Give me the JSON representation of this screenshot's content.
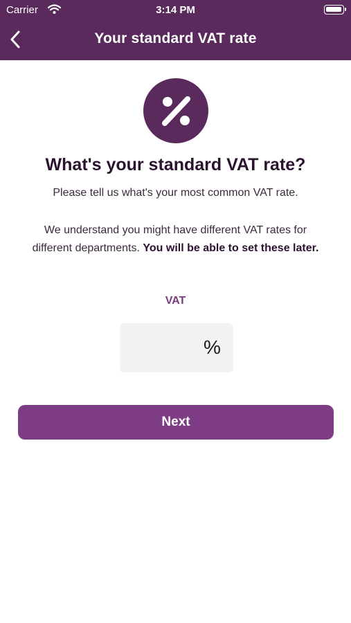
{
  "status_bar": {
    "carrier": "Carrier",
    "time": "3:14 PM",
    "wifi_icon": "wifi-icon",
    "battery_icon": "battery-icon"
  },
  "nav": {
    "title": "Your standard VAT rate",
    "back_icon": "chevron-left-icon"
  },
  "hero": {
    "icon": "percent-icon"
  },
  "content": {
    "question": "What's your standard VAT rate?",
    "subtitle": "Please tell us what's your most common VAT rate.",
    "explanation_regular": "We understand you might have different VAT rates for different departments. ",
    "explanation_bold": "You will be able to set these later."
  },
  "form": {
    "vat_label": "VAT",
    "vat_value": "",
    "vat_suffix": "%"
  },
  "actions": {
    "next_label": "Next"
  },
  "colors": {
    "header": "#5a2a5c",
    "accent": "#7e3c84",
    "label": "#7b3b7e",
    "field_bg": "#f2f2f2"
  }
}
